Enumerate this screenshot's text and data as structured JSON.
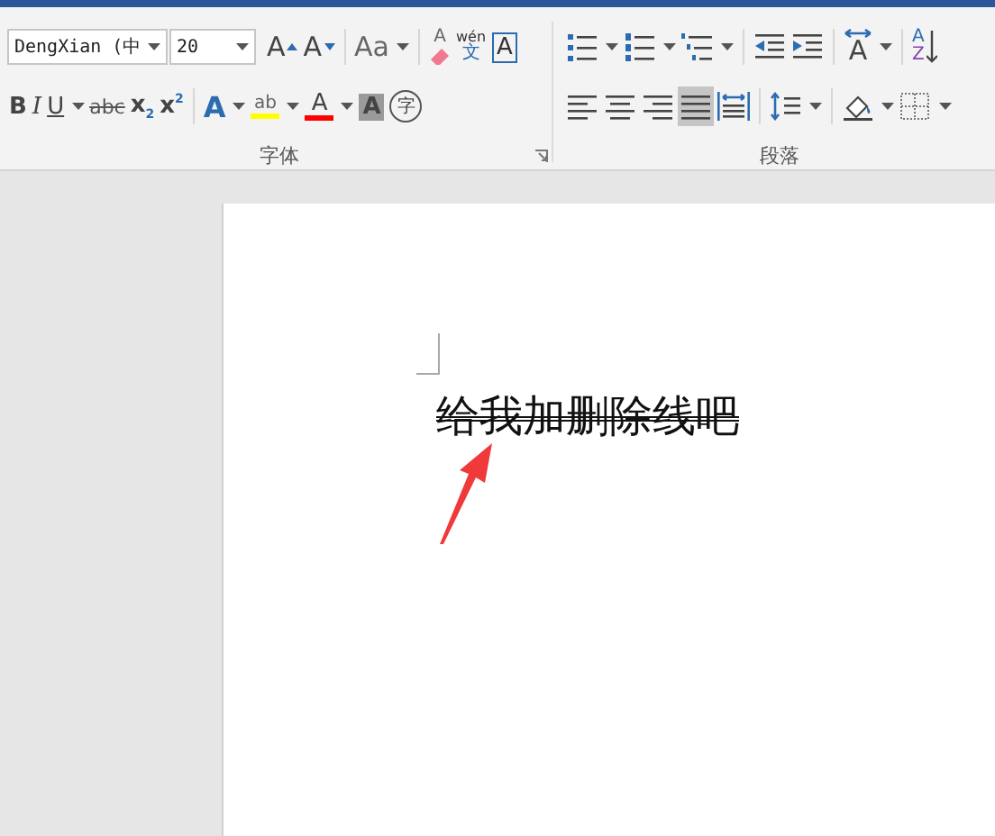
{
  "font_group": {
    "label": "字体",
    "font_name": "DengXian (中",
    "font_size": "20",
    "row1": [
      {
        "kind": "grow",
        "label": "A",
        "dropdown": false
      },
      {
        "kind": "shrink",
        "label": "A",
        "dropdown": false
      },
      {
        "kind": "sep"
      },
      {
        "kind": "case",
        "label": "Aa",
        "dropdown": true
      },
      {
        "kind": "sep"
      },
      {
        "kind": "clear",
        "label": "A",
        "dropdown": false
      },
      {
        "kind": "phonetic",
        "label": "wén",
        "sub": "文",
        "dropdown": false
      },
      {
        "kind": "boxed",
        "label": "A",
        "dropdown": false
      }
    ],
    "row2": [
      {
        "kind": "bold",
        "label": "B",
        "dropdown": false
      },
      {
        "kind": "italic",
        "label": "I",
        "dropdown": false
      },
      {
        "kind": "underline",
        "label": "U",
        "dropdown": true
      },
      {
        "kind": "strike",
        "label": "abc",
        "dropdown": false
      },
      {
        "kind": "subscript",
        "label": "x",
        "sub": "2",
        "dropdown": false
      },
      {
        "kind": "superscript",
        "label": "x",
        "sub": "2",
        "dropdown": false
      },
      {
        "kind": "sep"
      },
      {
        "kind": "effects",
        "label": "A",
        "dropdown": true
      },
      {
        "kind": "highlight",
        "label": "ab",
        "color": "#ffff00",
        "dropdown": true
      },
      {
        "kind": "fontcolor",
        "label": "A",
        "color": "#ff0000",
        "dropdown": true
      },
      {
        "kind": "shading",
        "label": "A",
        "dropdown": false
      },
      {
        "kind": "enclose",
        "label": "字",
        "dropdown": false
      }
    ]
  },
  "paragraph_group": {
    "label": "段落",
    "row1": [
      {
        "kind": "bullets",
        "dropdown": true
      },
      {
        "kind": "numbering",
        "dropdown": true
      },
      {
        "kind": "multilevel",
        "dropdown": true
      },
      {
        "kind": "sep"
      },
      {
        "kind": "outdent",
        "dropdown": false
      },
      {
        "kind": "indent",
        "dropdown": false
      },
      {
        "kind": "sep"
      },
      {
        "kind": "direction",
        "label": "A",
        "dropdown": true
      },
      {
        "kind": "sep"
      },
      {
        "kind": "sort",
        "label": "A",
        "sub": "Z",
        "dropdown": false
      }
    ],
    "row2": [
      {
        "kind": "align-left",
        "selected": false,
        "dropdown": false
      },
      {
        "kind": "align-center",
        "selected": false,
        "dropdown": false
      },
      {
        "kind": "align-right",
        "selected": false,
        "dropdown": false
      },
      {
        "kind": "justify",
        "selected": true,
        "dropdown": false
      },
      {
        "kind": "distributed",
        "selected": false,
        "dropdown": false
      },
      {
        "kind": "sep"
      },
      {
        "kind": "spacing",
        "dropdown": true
      },
      {
        "kind": "sep"
      },
      {
        "kind": "para-shading",
        "dropdown": true
      },
      {
        "kind": "borders",
        "dropdown": true
      }
    ]
  },
  "document": {
    "text": "给我加删除线吧",
    "annotation": {
      "kind": "arrow"
    }
  }
}
